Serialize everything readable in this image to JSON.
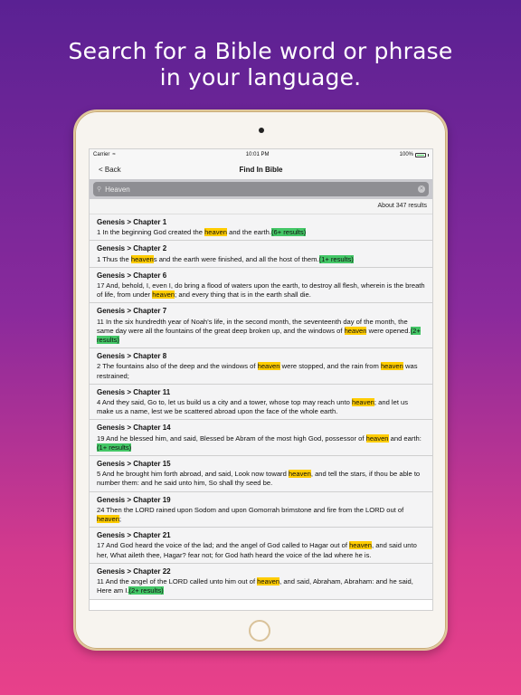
{
  "headline": {
    "line1": "Search for a Bible word or phrase",
    "line2": "in your language."
  },
  "status_bar": {
    "carrier": "Carrier",
    "time": "10:01 PM",
    "battery": "100%"
  },
  "nav": {
    "back_label": "< Back",
    "title": "Find In Bible"
  },
  "search": {
    "value": "Heaven"
  },
  "results_count": "About 347 results",
  "results": [
    {
      "title": "Genesis > Chapter 1",
      "segments": [
        {
          "t": "1 In the beginning God created the "
        },
        {
          "t": "heaven",
          "hl": true
        },
        {
          "t": " and the earth."
        },
        {
          "t": "(6+ results)",
          "badge": true
        }
      ]
    },
    {
      "title": "Genesis > Chapter 2",
      "segments": [
        {
          "t": "1 Thus the "
        },
        {
          "t": "heaven",
          "hl": true
        },
        {
          "t": "s and the earth were finished, and all the host of them."
        },
        {
          "t": "(1+ results)",
          "badge": true
        }
      ]
    },
    {
      "title": "Genesis > Chapter 6",
      "segments": [
        {
          "t": "17 And, behold, I, even I, do bring a flood of waters upon the earth, to destroy all flesh, wherein is the breath of life, from under "
        },
        {
          "t": "heaven",
          "hl": true
        },
        {
          "t": "; and every thing that is in the earth shall die."
        }
      ]
    },
    {
      "title": "Genesis > Chapter 7",
      "segments": [
        {
          "t": "11 In the six hundredth year of Noah's life, in the second month, the seventeenth day of the month, the same day were all the fountains of the great deep broken up, and the windows of "
        },
        {
          "t": "heaven",
          "hl": true
        },
        {
          "t": " were opened."
        },
        {
          "t": "(2+ results)",
          "badge": true
        }
      ]
    },
    {
      "title": "Genesis > Chapter 8",
      "segments": [
        {
          "t": "2 The fountains also of the deep and the windows of "
        },
        {
          "t": "heaven",
          "hl": true
        },
        {
          "t": " were stopped, and the rain from "
        },
        {
          "t": "heaven",
          "hl": true
        },
        {
          "t": " was restrained;"
        }
      ]
    },
    {
      "title": "Genesis > Chapter 11",
      "segments": [
        {
          "t": "4 And they said, Go to, let us build us a city and a tower, whose top may reach unto "
        },
        {
          "t": "heaven",
          "hl": true
        },
        {
          "t": "; and let us make us a name, lest we be scattered abroad upon the face of the whole earth."
        }
      ]
    },
    {
      "title": "Genesis > Chapter 14",
      "segments": [
        {
          "t": "19 And he blessed him, and said, Blessed be Abram of the most high God, possessor of "
        },
        {
          "t": "heaven",
          "hl": true
        },
        {
          "t": " and earth:"
        },
        {
          "t": "(1+ results)",
          "badge": true
        }
      ]
    },
    {
      "title": "Genesis > Chapter 15",
      "segments": [
        {
          "t": "5 And he brought him forth abroad, and said, Look now toward "
        },
        {
          "t": "heaven",
          "hl": true
        },
        {
          "t": ", and tell the stars, if thou be able to number them: and he said unto him, So shall thy seed be."
        }
      ]
    },
    {
      "title": "Genesis > Chapter 19",
      "segments": [
        {
          "t": "24 Then the LORD rained upon Sodom and upon Gomorrah brimstone and fire from the LORD out of "
        },
        {
          "t": "heaven",
          "hl": true
        },
        {
          "t": ";"
        }
      ]
    },
    {
      "title": "Genesis > Chapter 21",
      "segments": [
        {
          "t": "17 And God heard the voice of the lad; and the angel of God called to Hagar out of "
        },
        {
          "t": "heaven",
          "hl": true
        },
        {
          "t": ", and said unto her, What aileth thee, Hagar? fear not; for God hath heard the voice of the lad where he is."
        }
      ]
    },
    {
      "title": "Genesis > Chapter 22",
      "segments": [
        {
          "t": "11 And the angel of the LORD called unto him out of "
        },
        {
          "t": "heaven",
          "hl": true
        },
        {
          "t": ", and said, Abraham, Abraham: and he said, Here am I."
        },
        {
          "t": "(2+ results)",
          "badge": true
        }
      ]
    }
  ]
}
